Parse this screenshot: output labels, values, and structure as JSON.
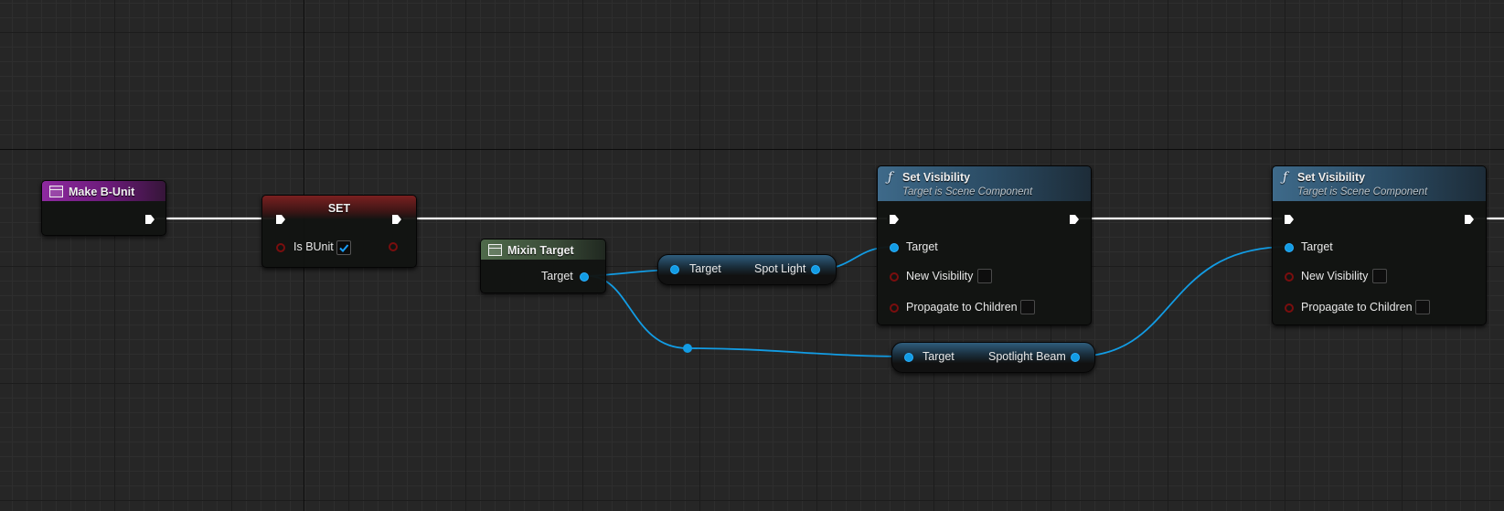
{
  "colors": {
    "background": "#262626",
    "exec_wire": "#ffffff",
    "object_wire": "#129ce4",
    "bool_pin": "#7a0e0e",
    "event_header": "#8e2aa0",
    "set_header": "#7a2020",
    "macro_header": "#4f6a4a",
    "function_header": "#3e6a8a"
  },
  "nodes": {
    "make_bunit": {
      "title": "Make B-Unit",
      "icon": "variable-icon"
    },
    "set_node": {
      "title": "SET",
      "input_label": "Is BUnit",
      "input_checked": true
    },
    "mixin_target": {
      "title": "Mixin Target",
      "output_label": "Target",
      "icon": "variable-icon"
    },
    "get_spot_light": {
      "input_label": "Target",
      "output_label": "Spot Light"
    },
    "get_spotlight_beam": {
      "input_label": "Target",
      "output_label": "Spotlight Beam"
    },
    "set_visibility_1": {
      "title": "Set Visibility",
      "subtitle": "Target is Scene Component",
      "glyph": "ƒ",
      "pins": [
        "Target",
        "New Visibility",
        "Propagate to Children"
      ]
    },
    "set_visibility_2": {
      "title": "Set Visibility",
      "subtitle": "Target is Scene Component",
      "glyph": "ƒ",
      "pins": [
        "Target",
        "New Visibility",
        "Propagate to Children"
      ]
    }
  }
}
